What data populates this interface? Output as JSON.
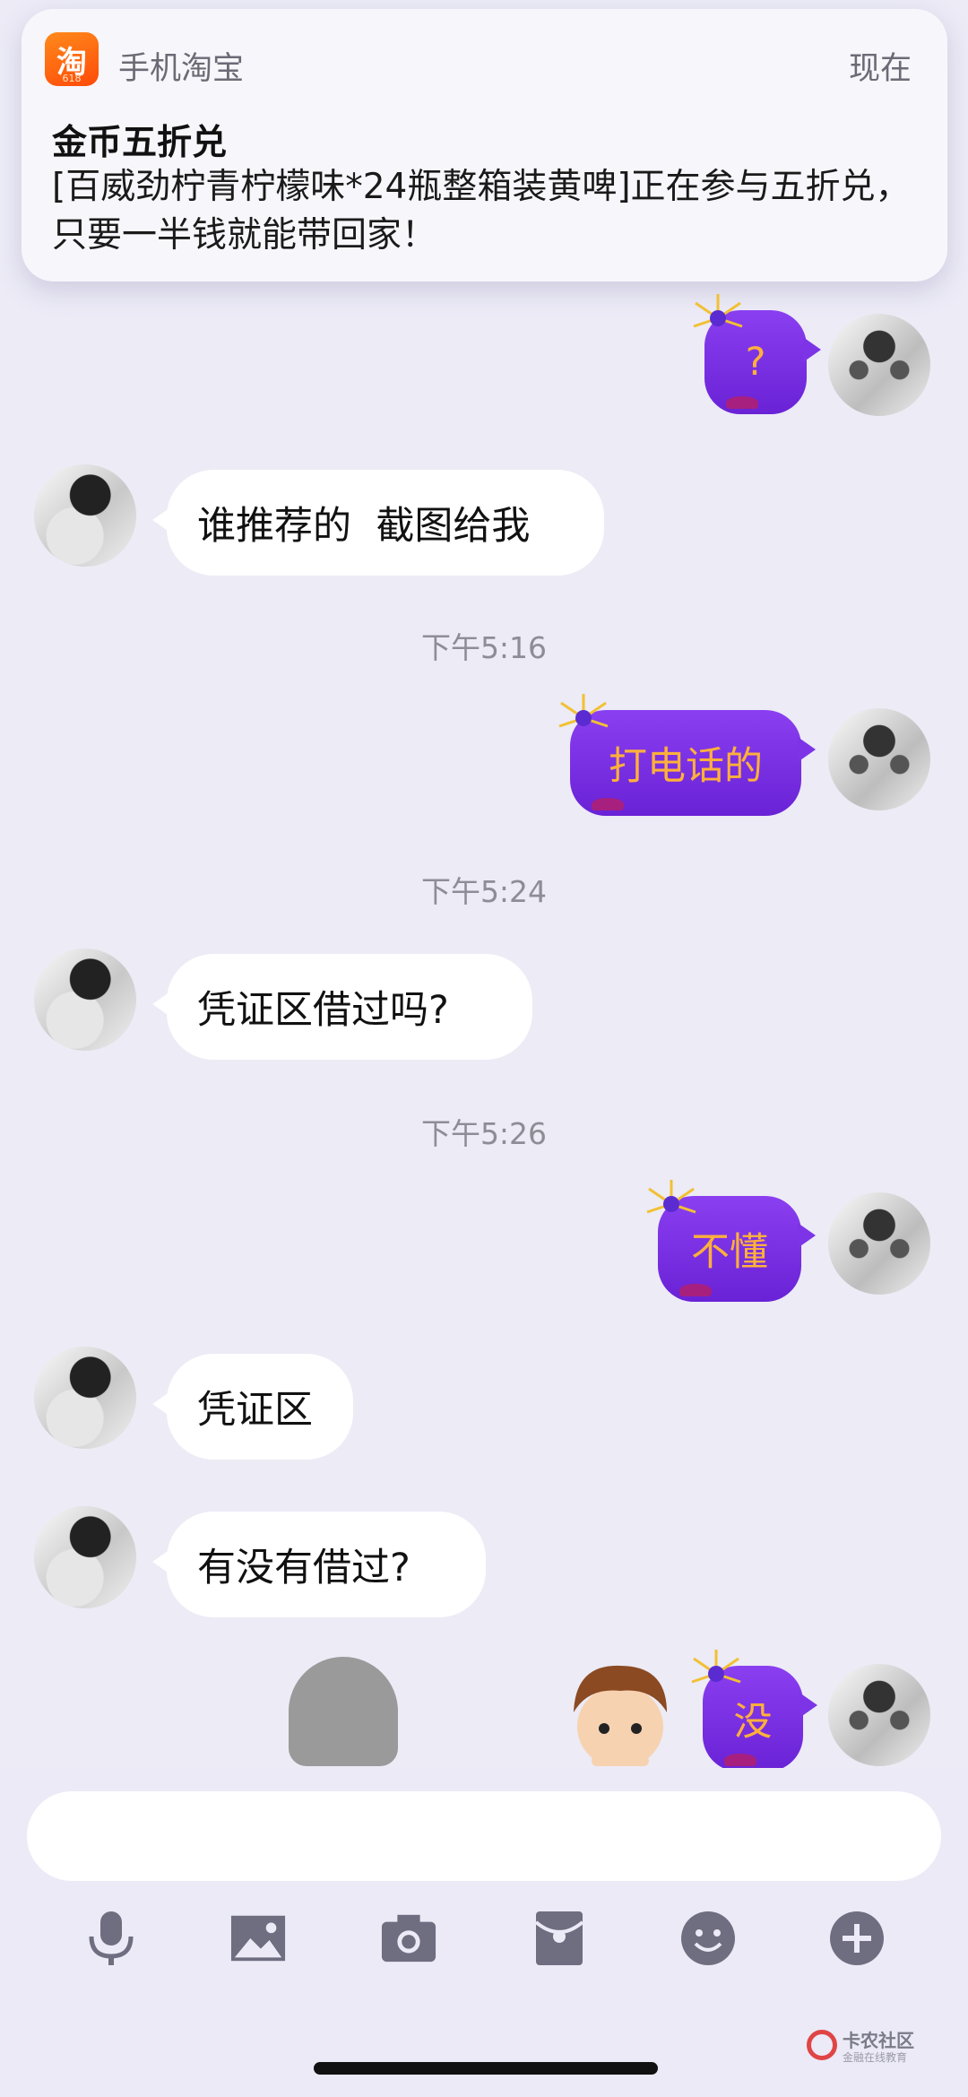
{
  "notification": {
    "app_icon_text": "淘",
    "app_icon_badge": "618",
    "app_name": "手机淘宝",
    "time": "现在",
    "title": "金币五折兑",
    "body": "[百威劲柠青柠檬味*24瓶整箱装黄啤]正在参与五折兑，只要一半钱就能带回家！"
  },
  "messages": [
    {
      "id": "m1",
      "side": "out",
      "text": "?"
    },
    {
      "id": "m2",
      "side": "in",
      "text": "谁推荐的  截图给我"
    },
    {
      "id": "t1",
      "type": "time",
      "text": "下午5:16"
    },
    {
      "id": "m3",
      "side": "out",
      "text": "打电话的"
    },
    {
      "id": "t2",
      "type": "time",
      "text": "下午5:24"
    },
    {
      "id": "m4",
      "side": "in",
      "text": "凭证区借过吗?"
    },
    {
      "id": "t3",
      "type": "time",
      "text": "下午5:26"
    },
    {
      "id": "m5",
      "side": "out",
      "text": "不懂"
    },
    {
      "id": "m6",
      "side": "in",
      "text": "凭证区"
    },
    {
      "id": "m7",
      "side": "in",
      "text": "有没有借过?"
    },
    {
      "id": "m8",
      "side": "out",
      "text": "没"
    }
  ],
  "composer": {
    "input_value": "",
    "toolbar": [
      "microphone-icon",
      "image-icon",
      "camera-icon",
      "red-packet-icon",
      "emoji-icon",
      "plus-icon"
    ]
  },
  "watermark": {
    "title": "卡农社区",
    "subtitle": "金融在线教育"
  },
  "colors": {
    "background": "#ecebf6",
    "bubble_in": "#ffffff",
    "bubble_out": "#7a30e6",
    "bubble_out_text": "#ffb03b",
    "timestamp": "#8e8d96",
    "icon": "#6f6e80"
  }
}
